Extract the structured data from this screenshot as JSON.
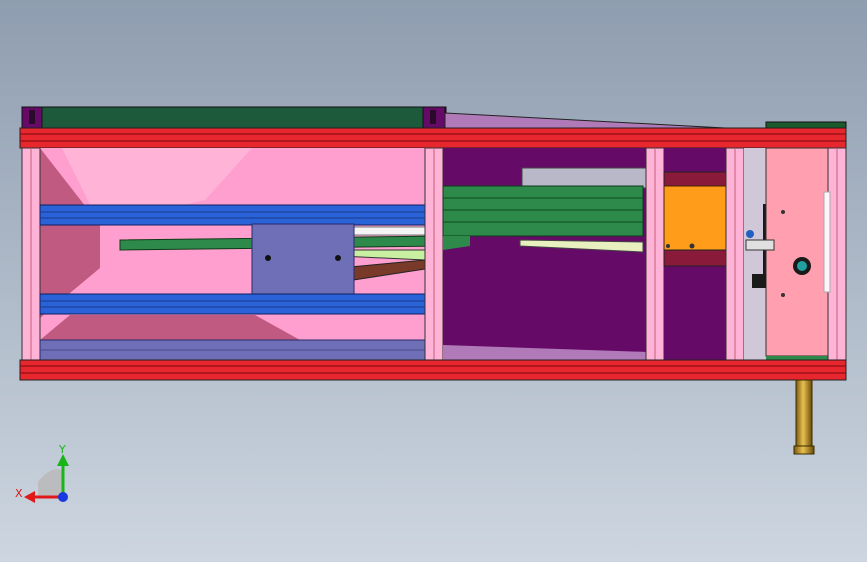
{
  "viewport": {
    "background_top": "#8f9db0",
    "background_bottom": "#cdd6e0"
  },
  "colors": {
    "frame_red": "#e8262d",
    "frame_red_dark": "#a0141a",
    "pink": "#ff9fcf",
    "pink_dark": "#c05a80",
    "pink_light": "#ffb3d6",
    "dark_green": "#1d5a3c",
    "blue": "#2a62d8",
    "blue_dark": "#17399a",
    "slate": "#6f6fb8",
    "green": "#2e8a4a",
    "green_dark": "#1b5a2c",
    "purple": "#660a68",
    "purple_light": "#b07ab8",
    "orange": "#ff9d1a",
    "maroon": "#8a1a3a",
    "brass": "#c99a2a",
    "white": "#f4f4f4",
    "axis_x": "#e01818",
    "axis_y": "#18b418",
    "axis_z": "#1838e0"
  },
  "triad": {
    "x_label": "X",
    "y_label": "Y",
    "x_icon": "x-axis-arrow-icon",
    "y_icon": "y-axis-arrow-icon",
    "z_icon": "z-axis-dot-icon"
  }
}
